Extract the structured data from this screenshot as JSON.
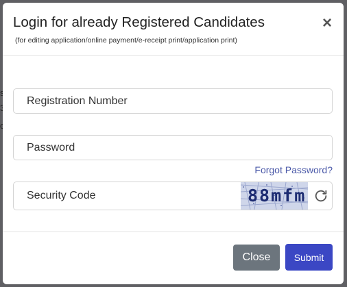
{
  "modal": {
    "title": "Login for already Registered Candidates",
    "subtitle": "(for editing application/online payment/e-receipt print/application print)",
    "close_glyph": "×"
  },
  "form": {
    "registration_placeholder": "Registration Number",
    "registration_value": "",
    "password_placeholder": "Password",
    "password_value": "",
    "forgot_password": "Forgot Password?",
    "security_placeholder": "Security Code",
    "security_value": "",
    "captcha_text": "88mfm"
  },
  "buttons": {
    "close_label": "Close",
    "submit_label": "Submit"
  },
  "colors": {
    "backdrop": "#5f5f63",
    "link": "#4a58a8",
    "close_button": "#6c757d",
    "submit_button": "#3b47c4",
    "captcha_bg": "#cfd6ea",
    "captcha_text": "#1d2c72"
  },
  "icons": {
    "refresh": "refresh-icon",
    "close": "close-icon"
  }
}
